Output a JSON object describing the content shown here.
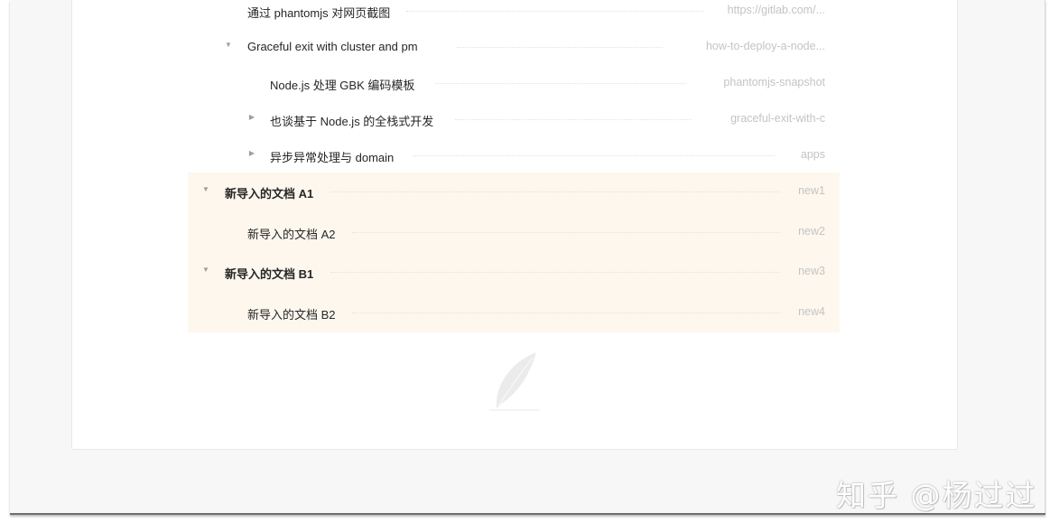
{
  "tree": [
    {
      "title": "通过 phantomjs 对网页截图",
      "slug": "https://gitlab.com/...",
      "arrow": "",
      "bold": false
    },
    {
      "title": "Graceful exit with cluster and pm",
      "slug": "how-to-deploy-a-node...",
      "arrow": "▼",
      "bold": false
    },
    {
      "title": "Node.js 处理 GBK 编码模板",
      "slug": "phantomjs-snapshot",
      "arrow": "",
      "bold": false
    },
    {
      "title": "也谈基于 Node.js 的全栈式开发",
      "slug": "graceful-exit-with-c",
      "arrow": "▶",
      "bold": false
    },
    {
      "title": "异步异常处理与 domain",
      "slug": "apps",
      "arrow": "▶",
      "bold": false
    },
    {
      "title": "新导入的文档 A1",
      "slug": "new1",
      "arrow": "▼",
      "bold": true
    },
    {
      "title": "新导入的文档 A2",
      "slug": "new2",
      "arrow": "",
      "bold": false
    },
    {
      "title": "新导入的文档 B1",
      "slug": "new3",
      "arrow": "▼",
      "bold": true
    },
    {
      "title": "新导入的文档 B2",
      "slug": "new4",
      "arrow": "",
      "bold": false
    }
  ],
  "empty_state": {
    "icon": "feather-icon"
  },
  "watermark": "知乎 @杨过过"
}
